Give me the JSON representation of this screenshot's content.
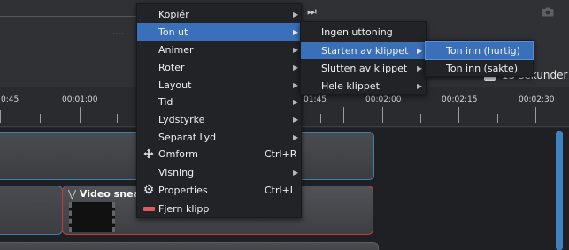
{
  "toolbar": {
    "dots": ".....",
    "media_end_glyph": "⏭",
    "camera_icon": "camera-icon",
    "timescale_label": "15 sekunder"
  },
  "ruler": {
    "labels": [
      "0:45",
      "00:01:00",
      "01:45",
      "00:02:00",
      "00:02:15",
      "00:02:30"
    ]
  },
  "clip": {
    "title": "Video sneak"
  },
  "main_menu": {
    "items": [
      {
        "label": "Kopiér",
        "submenu": true
      },
      {
        "label": "Ton ut",
        "submenu": true,
        "highlighted": true
      },
      {
        "label": "Animer",
        "submenu": true
      },
      {
        "label": "Roter",
        "submenu": true
      },
      {
        "label": "Layout",
        "submenu": true
      },
      {
        "label": "Tid",
        "submenu": true
      },
      {
        "label": "Lydstyrke",
        "submenu": true
      },
      {
        "label": "Separat Lyd",
        "submenu": true
      },
      {
        "label": "Omform",
        "shortcut": "Ctrl+R",
        "icon": "move-arrows-icon"
      },
      {
        "label": "Visning",
        "submenu": true
      },
      {
        "label": "Properties",
        "shortcut": "Ctrl+I",
        "icon": "gear-icon"
      },
      {
        "label": "Fjern klipp",
        "icon": "remove-bar-icon"
      }
    ]
  },
  "fade_menu": {
    "items": [
      {
        "label": "Ingen uttoning"
      },
      {
        "label": "Starten av klippet",
        "submenu": true,
        "highlighted": true
      },
      {
        "label": "Slutten av klippet",
        "submenu": true
      },
      {
        "label": "Hele klippet",
        "submenu": true
      }
    ]
  },
  "speed_menu": {
    "items": [
      {
        "label": "Ton inn (hurtig)",
        "highlighted": true
      },
      {
        "label": "Ton inn (sakte)"
      }
    ]
  },
  "colors": {
    "highlight": "#3a6fb9",
    "clip_selected_border": "#c43a3a",
    "clip_border_blue": "#3d7fb0",
    "remove_icon": "#e05a5a"
  }
}
